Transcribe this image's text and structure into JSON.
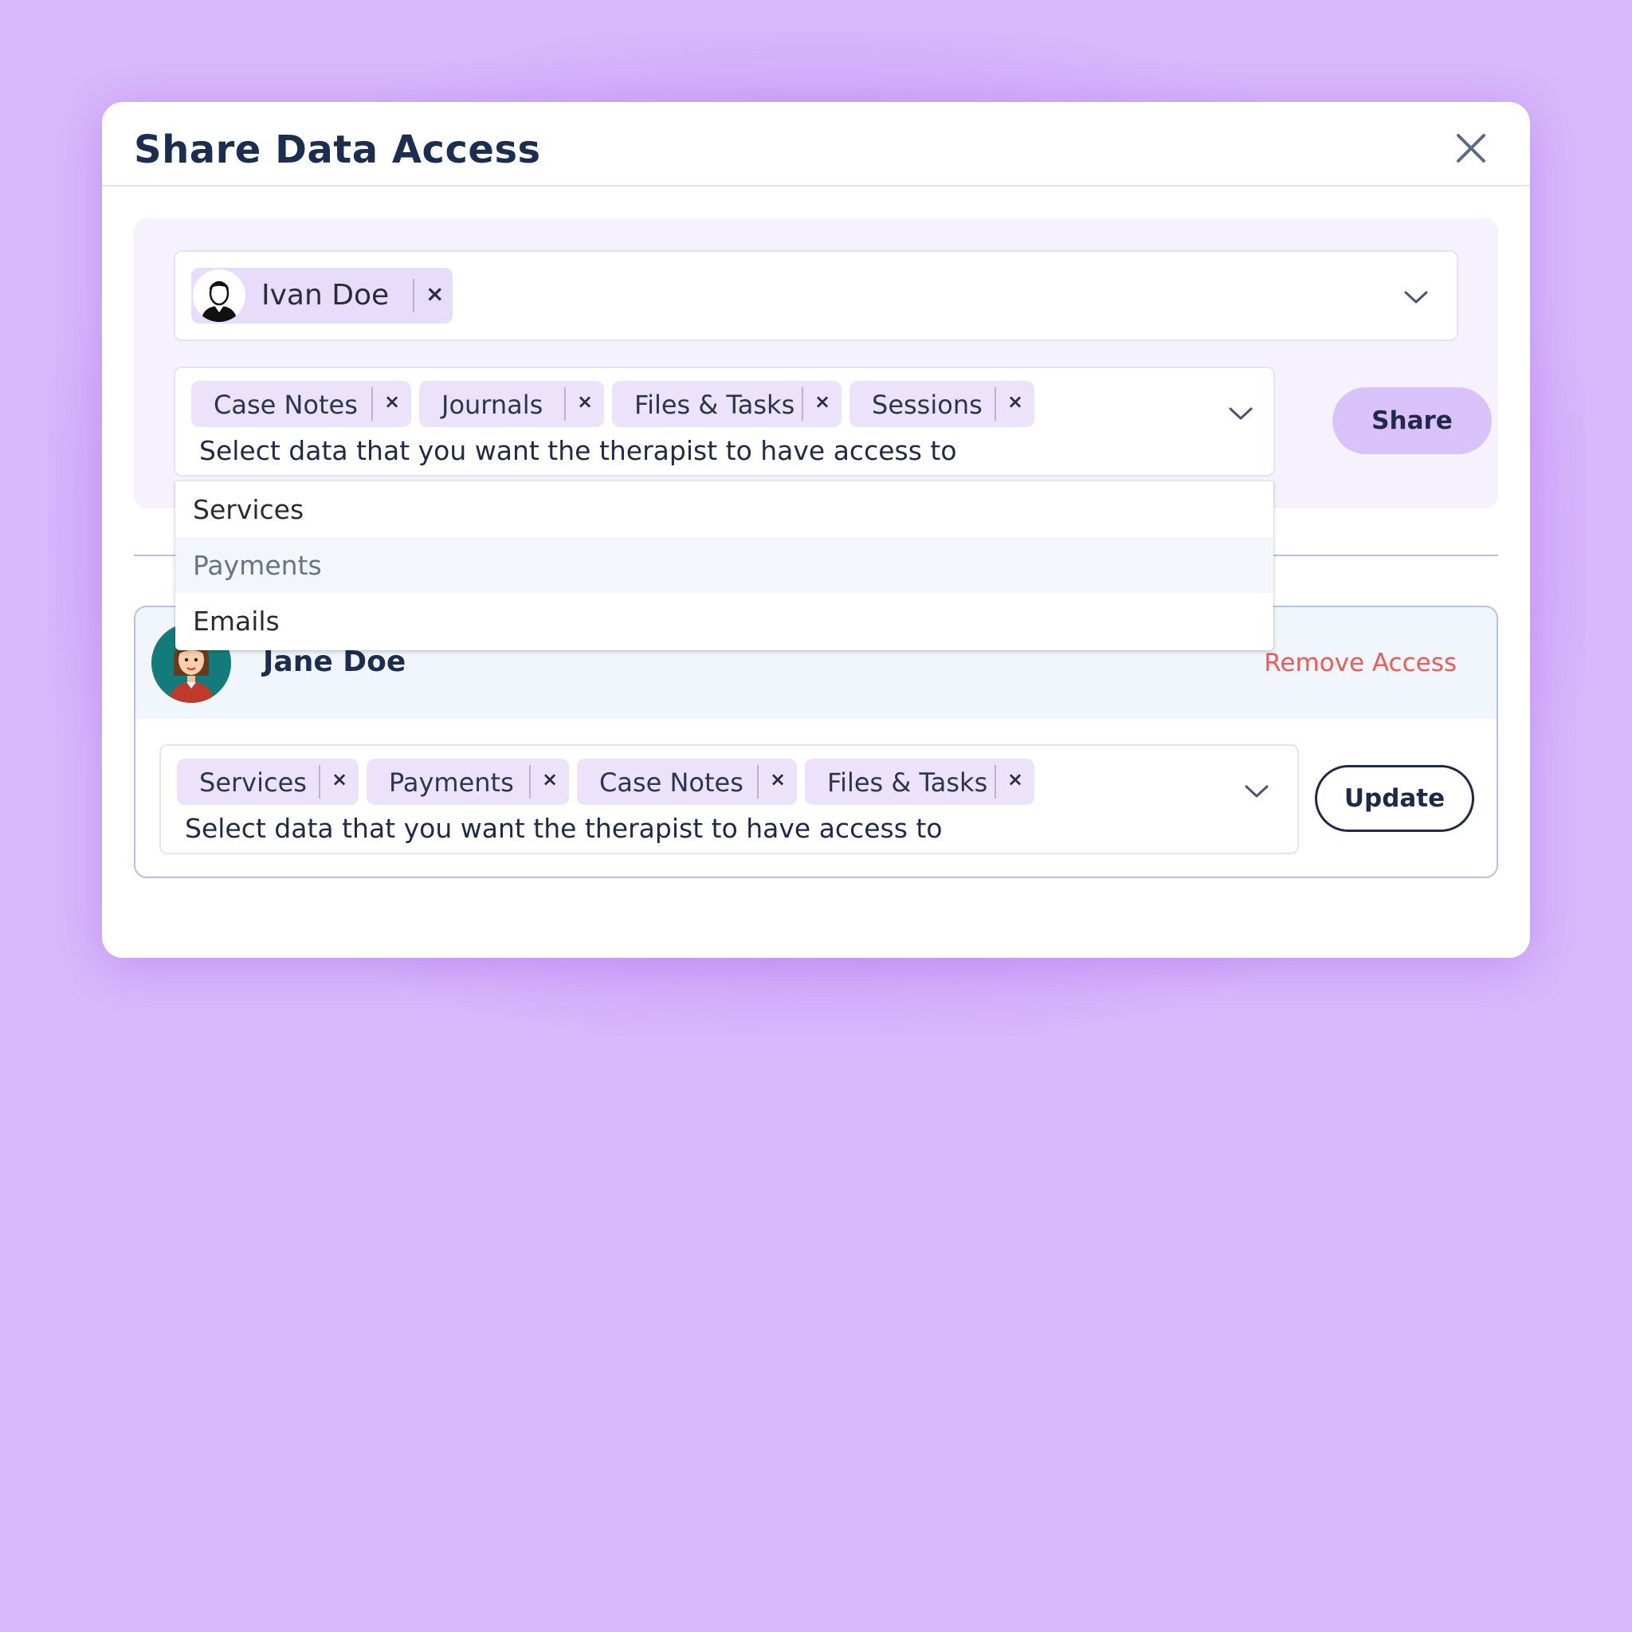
{
  "modal": {
    "title": "Share Data Access"
  },
  "share_form": {
    "selected_person": "Ivan Doe",
    "tags": [
      "Case Notes",
      "Journals",
      "Files & Tasks",
      "Sessions"
    ],
    "placeholder": "Select data that you want the therapist to have access to",
    "share_label": "Share"
  },
  "dropdown": {
    "options": [
      "Services",
      "Payments",
      "Emails"
    ],
    "highlighted": "Payments"
  },
  "access_entry": {
    "name": "Jane Doe",
    "remove_label": "Remove Access",
    "tags": [
      "Services",
      "Payments",
      "Case Notes",
      "Files & Tasks"
    ],
    "placeholder": "Select data that you want the therapist to have access to",
    "update_label": "Update"
  },
  "colors": {
    "background": "#d9b8fb",
    "accent": "#d9c2fa",
    "tag": "#ece3fb",
    "danger": "#ef5a56",
    "text": "#1b2d50"
  },
  "icons": [
    "close-icon",
    "chevron-down-icon",
    "remove-tag-icon",
    "male-avatar-icon",
    "female-avatar-icon"
  ]
}
